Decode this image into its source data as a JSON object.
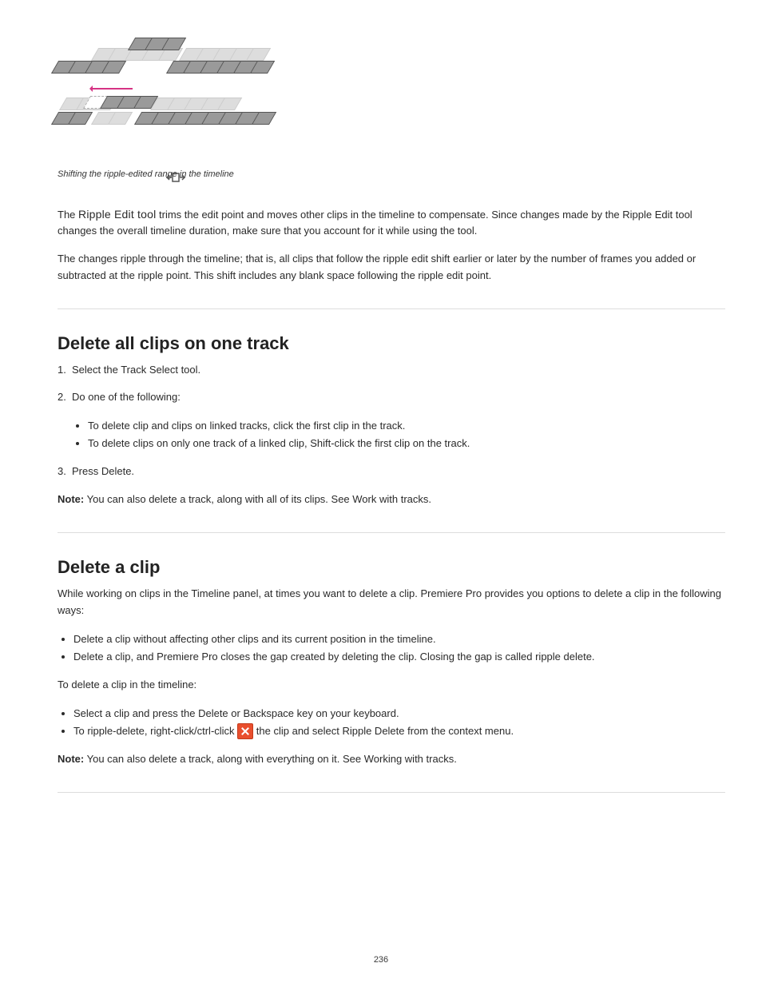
{
  "figure": {
    "caption": "Shifting the ripple-edited range in the timeline",
    "ripple_tool_name": "Ripple Edit tool"
  },
  "para1_prefix": "The ",
  "para1_after_tool": " trims the edit point and moves other clips in the timeline to compensate. Since changes made by the Ripple Edit tool changes the overall timeline duration, make sure that you account for it while using the tool.",
  "para2": "The changes ripple through the timeline; that is, all clips that follow the ripple edit shift earlier or later by the number of frames you added or subtracted at the ripple point. This shift includes any blank space following the ripple edit point.",
  "section1": {
    "heading": "Delete all clips on one track",
    "steps_intro": "",
    "step1": "Select the Track Select tool.",
    "step2": "Do one of the following:",
    "step2a": "To delete clip and clips on linked tracks, click the first clip in the track.",
    "step2b": "To delete clips on only one track of a linked clip, Shift-click the first clip on the track.",
    "step3": "Press Delete.",
    "note_label": "Note:",
    "note_text": "You can also delete a track, along with all of its clips. See Work with tracks."
  },
  "section2": {
    "heading": "Delete a clip",
    "para": "While working on clips in the Timeline panel, at times you want to delete a clip. Premiere Pro provides you options to delete a clip in the following ways:",
    "bullet1": "Delete a clip without affecting other clips and its current position in the timeline.",
    "bullet2": "Delete a clip, and Premiere Pro closes the gap created by deleting the clip. Closing the gap is called ripple delete.",
    "para2": "To delete a clip in the timeline:",
    "bullet3": "Select a clip and press the Delete or Backspace key on your keyboard.",
    "bullet4_prefix": "To ripple-delete, right-click/ctrl-click ",
    "bullet4_suffix": " the clip and select Ripple Delete from the context menu.",
    "note_label": "Note:",
    "note_text": "You can also delete a track, along with everything on it. See Working with tracks."
  },
  "page_number": "236"
}
